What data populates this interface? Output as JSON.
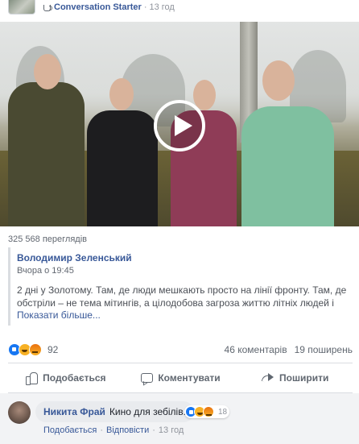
{
  "post": {
    "badge_label": "Conversation Starter",
    "dot": "·",
    "time": "13 год"
  },
  "video": {
    "views": "325 568 переглядів"
  },
  "shared": {
    "author": "Володимир Зеленський",
    "date": "Вчора о 19:45",
    "text": "2 дні у Золотому. Там, де люди мешкають просто на лінії фронту. Там, де обстріли – не тема мітингів, а цілодобова загроза життю літніх людей і дітей. Там, де вс...",
    "see_more": "Показати більше..."
  },
  "stats": {
    "reactions_count": "92",
    "comments": "46 коментарів",
    "shares": "19 поширень"
  },
  "actions": {
    "like": "Подобається",
    "comment": "Коментувати",
    "share": "Поширити"
  },
  "comment": {
    "author": "Никита Фрай",
    "text": "Кино для зебілів.",
    "reactions_count": "18",
    "like_link": "Подобається",
    "reply_link": "Відповісти",
    "separator": "·",
    "time": "13 год"
  },
  "colors": {
    "link": "#385898",
    "like_blue": "#1877f2",
    "muted": "#606770"
  }
}
